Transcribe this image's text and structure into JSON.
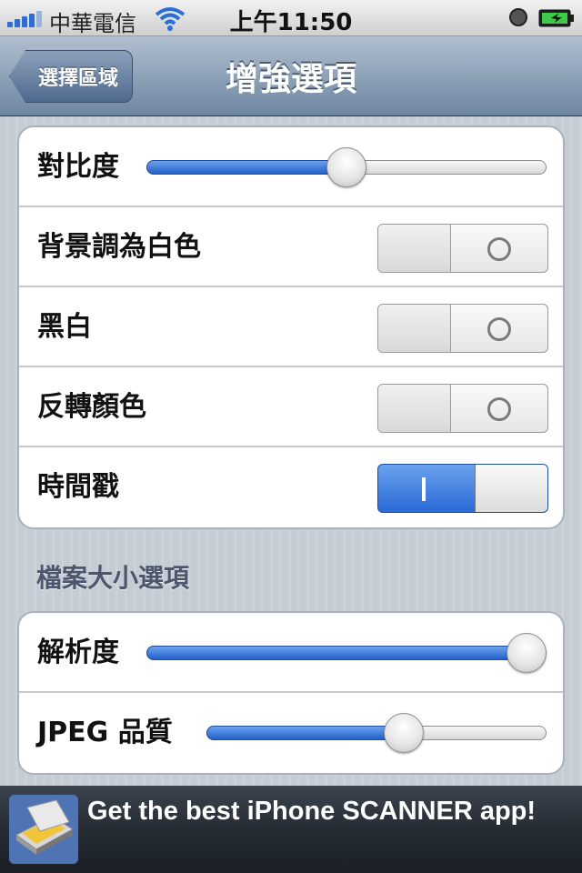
{
  "status_bar": {
    "carrier": "中華電信",
    "time": "上午11:50",
    "icons": [
      "signal-icon",
      "wifi-icon",
      "alarm-icon",
      "battery-charging-icon"
    ]
  },
  "nav": {
    "back_label": "選擇區域",
    "title": "增強選項"
  },
  "enhance_group": {
    "contrast": {
      "label": "對比度",
      "value": 0.5
    },
    "white_background": {
      "label": "背景調為白色",
      "on": false
    },
    "black_white": {
      "label": "黑白",
      "on": false
    },
    "invert_colors": {
      "label": "反轉顏色",
      "on": false
    },
    "timestamp": {
      "label": "時間戳",
      "on": true
    }
  },
  "file_size_header": "檔案大小選項",
  "file_size_group": {
    "resolution": {
      "label": "解析度",
      "value": 1.0
    },
    "jpeg_quality": {
      "label": "JPEG 品質",
      "value": 0.59
    }
  },
  "ad": {
    "text": "Get the best iPhone SCANNER app!",
    "icon": "scanner-app-icon"
  },
  "colors": {
    "accent": "#2a69d6",
    "navbar": "#8ea2b8"
  }
}
